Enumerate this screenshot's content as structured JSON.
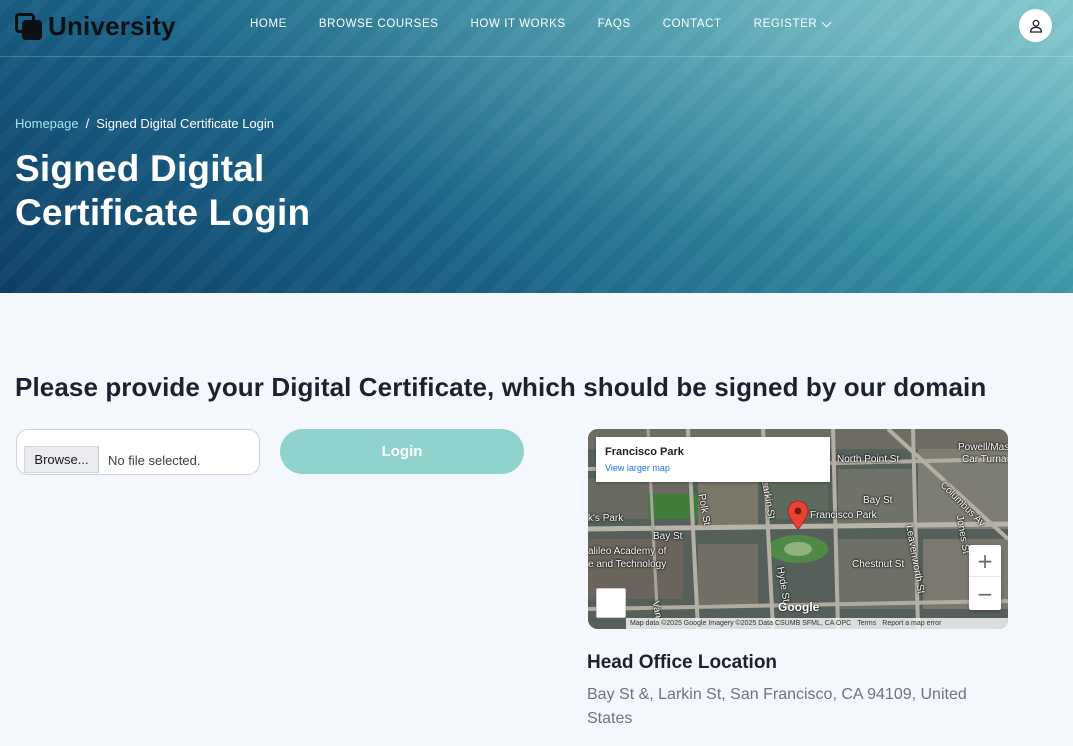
{
  "brand": {
    "name": "University"
  },
  "nav": {
    "items": [
      {
        "label": "HOME"
      },
      {
        "label": "BROWSE COURSES"
      },
      {
        "label": "HOW IT WORKS"
      },
      {
        "label": "FAQS"
      },
      {
        "label": "CONTACT"
      },
      {
        "label": "REGISTER"
      }
    ]
  },
  "breadcrumb": {
    "home": "Homepage",
    "separator": "/",
    "current": "Signed Digital Certificate Login"
  },
  "page": {
    "title": "Signed Digital Certificate Login"
  },
  "main": {
    "prompt": "Please provide your Digital Certificate, which should be signed by our domain",
    "file_input": {
      "button_label": "Browse...",
      "status": "No file selected."
    },
    "login_button": "Login"
  },
  "map": {
    "place_name": "Francisco Park",
    "larger_map_link": "View larger map",
    "labels": {
      "park": "Francisco Park",
      "north_point": "North Point St",
      "powell": "Powell/Mason",
      "car_turnaround": "Car Turna",
      "bay_st": "Bay St",
      "bay_st_2": "Bay St",
      "chestnut": "Chestnut St",
      "columbus": "Columbus Av",
      "galileo": "alileo Academy of",
      "galileo_2": "e and Technology",
      "ks_park": "k's Park",
      "polk": "Polk St",
      "larkin": "Larkin St",
      "leavenworth": "Leavenworth St",
      "hyde": "Hyde St",
      "jones": "Jones St",
      "van": "Van"
    },
    "google": "Google",
    "footer": {
      "data": "Map data ©2025 Google Imagery ©2025 Data CSUMB SFML, CA OPC",
      "terms": "Terms",
      "report": "Report a map error"
    },
    "zoom_in": "+",
    "zoom_out": "−"
  },
  "office": {
    "title": "Head Office Location",
    "address": "Bay St &, Larkin St, San Francisco, CA 94109, United States"
  },
  "icons": {
    "logo": "logo-icon",
    "user": "user-icon",
    "chevron": "chevron-down-icon"
  },
  "colors": {
    "hero_start": "#0e3e66",
    "hero_end": "#73c2c7",
    "login_button": "#8fd3cc",
    "background": "#f4f8fd"
  }
}
